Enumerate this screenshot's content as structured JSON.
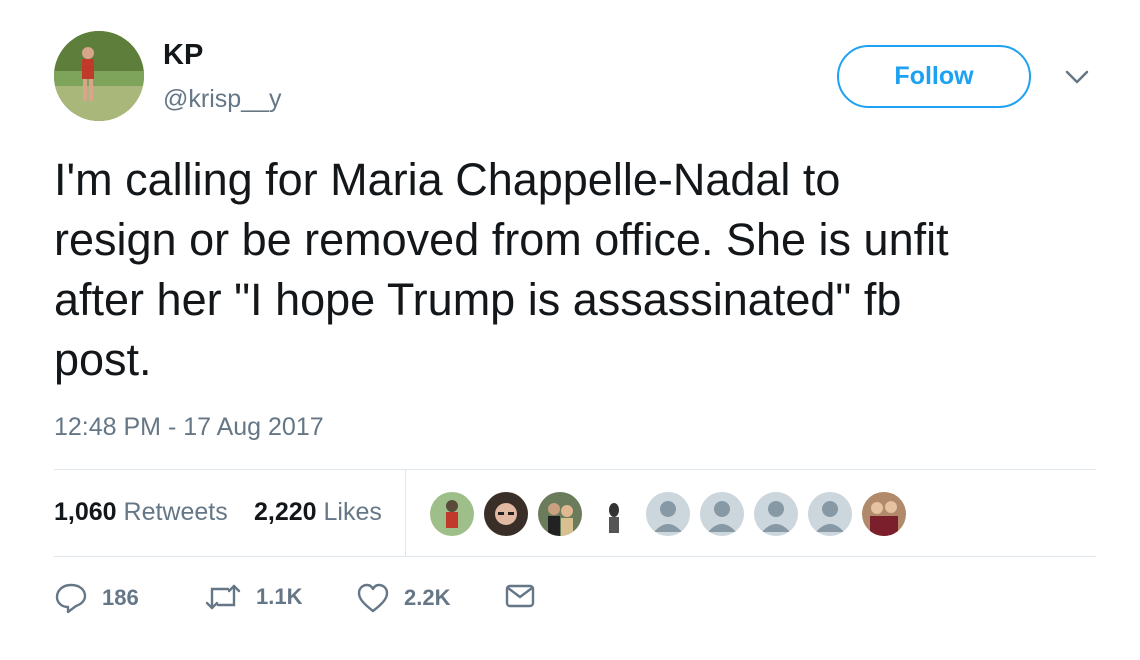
{
  "user": {
    "display_name": "KP",
    "handle": "@krisp__y",
    "follow_label": "Follow"
  },
  "tweet": {
    "text": "I'm calling for Maria Chappelle-Nadal to\nresign or be removed from office. She is unfit\nafter her \"I hope Trump is assassinated\" fb\npost.",
    "timestamp": "12:48 PM - 17 Aug 2017"
  },
  "stats": {
    "retweets_count": "1,060",
    "retweets_label": "Retweets",
    "likes_count": "2,220",
    "likes_label": "Likes"
  },
  "actions": {
    "reply_count": "186",
    "retweet_count": "1.1K",
    "like_count": "2.2K"
  },
  "colors": {
    "accent": "#1da1f2",
    "secondary_text": "#657786",
    "divider": "#e1e8ed"
  }
}
